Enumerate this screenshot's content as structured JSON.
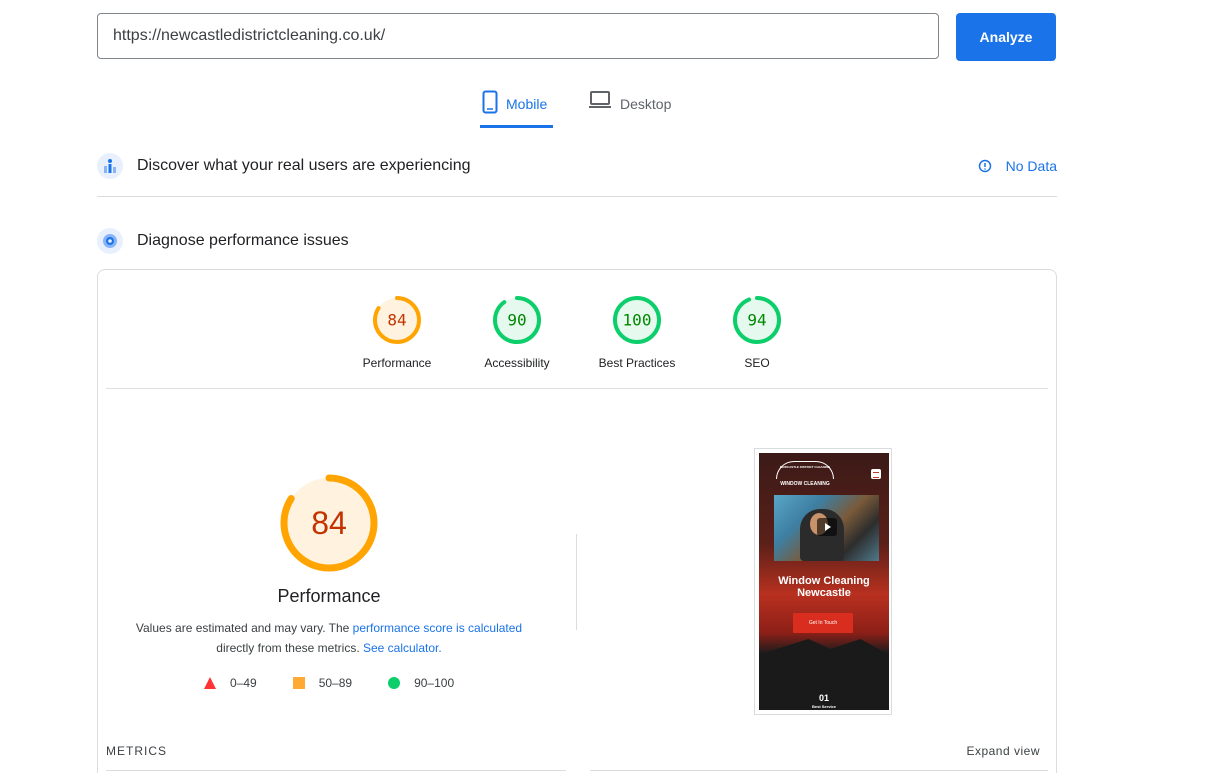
{
  "search": {
    "url_value": "https://newcastledistrictcleaning.co.uk/",
    "analyze_label": "Analyze"
  },
  "tabs": [
    {
      "label": "Mobile",
      "active": true,
      "icon": "mobile-phone-icon"
    },
    {
      "label": "Desktop",
      "active": false,
      "icon": "laptop-icon"
    }
  ],
  "crux": {
    "title": "Discover what your real users are experiencing",
    "status": "No Data",
    "icon": "people-chart-icon",
    "status_icon": "info-icon"
  },
  "diagnose": {
    "title": "Diagnose performance issues",
    "icon": "lighthouse-icon"
  },
  "scores": [
    {
      "label": "Performance",
      "value": "84",
      "fraction": 0.84,
      "rating": "average"
    },
    {
      "label": "Accessibility",
      "value": "90",
      "fraction": 0.9,
      "rating": "pass"
    },
    {
      "label": "Best Practices",
      "value": "100",
      "fraction": 1.0,
      "rating": "pass"
    },
    {
      "label": "SEO",
      "value": "94",
      "fraction": 0.94,
      "rating": "pass"
    }
  ],
  "performance": {
    "score": "84",
    "fraction": 0.84,
    "title": "Performance",
    "desc_prefix": "Values are estimated and may vary. The ",
    "desc_link1": "performance score is calculated",
    "desc_middle": " directly from these metrics. ",
    "desc_link2": "See calculator."
  },
  "legend": [
    {
      "range": "0–49",
      "shape": "triangle",
      "color": "#ff3333"
    },
    {
      "range": "50–89",
      "shape": "square",
      "color": "#ffaa33"
    },
    {
      "range": "90–100",
      "shape": "circle",
      "color": "#0cce6b"
    }
  ],
  "screenshot": {
    "logo_line1": "NEWCASTLE DISTRICT CLEANING",
    "logo_line2": "WINDOW CLEANING",
    "heading": "Window Cleaning Newcastle",
    "cta": "Get In Touch",
    "number": "01",
    "sub": "Best Service"
  },
  "metrics": {
    "label": "METRICS",
    "expand": "Expand view"
  },
  "colors": {
    "accent": "#1a73e8",
    "average": "#ffa400",
    "average_text": "#c33300",
    "average_bg": "#fff3e0",
    "pass": "#0cce6b",
    "pass_text": "#008800",
    "pass_bg": "#e6f9ee"
  }
}
